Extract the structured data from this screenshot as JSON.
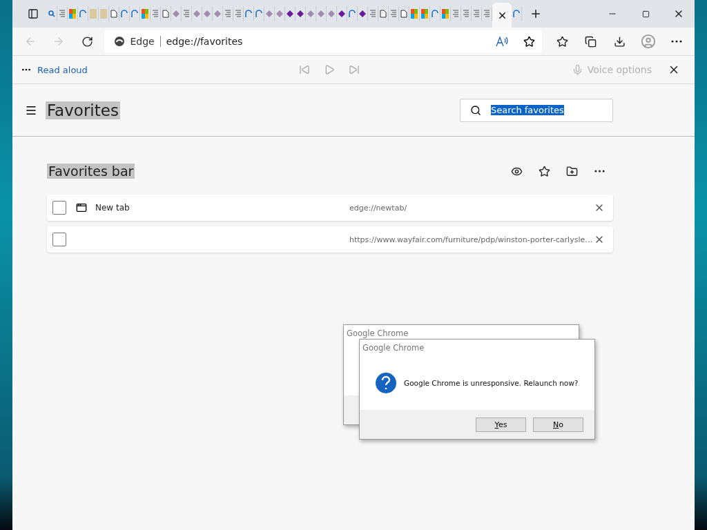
{
  "tabs": [
    {
      "kind": "search",
      "selected": false
    },
    {
      "kind": "doc",
      "selected": false
    },
    {
      "kind": "tiles",
      "selected": false
    },
    {
      "kind": "arc",
      "selected": false
    },
    {
      "kind": "pale",
      "selected": false
    },
    {
      "kind": "pale",
      "selected": false
    },
    {
      "kind": "page",
      "selected": false
    },
    {
      "kind": "arc",
      "selected": false
    },
    {
      "kind": "arc",
      "selected": false
    },
    {
      "kind": "tiles",
      "selected": false
    },
    {
      "kind": "doc",
      "selected": false
    },
    {
      "kind": "page",
      "selected": false
    },
    {
      "kind": "diamond",
      "selected": false
    },
    {
      "kind": "doc",
      "selected": false
    },
    {
      "kind": "diamond",
      "selected": false
    },
    {
      "kind": "diamond",
      "selected": false
    },
    {
      "kind": "diamond",
      "selected": false
    },
    {
      "kind": "doc",
      "selected": false
    },
    {
      "kind": "doc",
      "selected": false
    },
    {
      "kind": "arc",
      "selected": false
    },
    {
      "kind": "arc",
      "selected": false
    },
    {
      "kind": "diamond",
      "selected": false
    },
    {
      "kind": "diamond",
      "selected": false
    },
    {
      "kind": "purple",
      "selected": false
    },
    {
      "kind": "purple",
      "selected": false
    },
    {
      "kind": "diamond",
      "selected": false
    },
    {
      "kind": "diamond",
      "selected": false
    },
    {
      "kind": "diamond",
      "selected": false
    },
    {
      "kind": "purple",
      "selected": false
    },
    {
      "kind": "arc",
      "selected": false
    },
    {
      "kind": "purple",
      "selected": false
    },
    {
      "kind": "doc",
      "selected": false
    },
    {
      "kind": "page",
      "selected": false
    },
    {
      "kind": "doc",
      "selected": false
    },
    {
      "kind": "page",
      "selected": false
    },
    {
      "kind": "tiles",
      "selected": false
    },
    {
      "kind": "tiles",
      "selected": false
    },
    {
      "kind": "arc",
      "selected": false
    },
    {
      "kind": "tiles",
      "selected": false
    },
    {
      "kind": "doc",
      "selected": false
    },
    {
      "kind": "doc",
      "selected": false
    },
    {
      "kind": "doc",
      "selected": false
    },
    {
      "kind": "doc",
      "selected": false
    },
    {
      "kind": "blank",
      "selected": true
    },
    {
      "kind": "arc",
      "selected": false
    }
  ],
  "address": {
    "site": "Edge",
    "url": "edge://favorites"
  },
  "read_aloud": {
    "label": "Read aloud",
    "voice_options": "Voice options"
  },
  "page": {
    "title": "Favorites",
    "title_selected": true,
    "search": {
      "value": "Search favorites",
      "selected": true
    }
  },
  "folder": {
    "title": "Favorites bar",
    "title_selected": true,
    "items": [
      {
        "kind": "page",
        "name": "New tab",
        "url": "edge://newtab/",
        "checked": false
      },
      {
        "kind": "blank",
        "url": "https://www.wayfair.com/furniture/pdp/winston-porter-carlysle…",
        "checked": false
      }
    ]
  },
  "dialogs": [
    {
      "title": "Google Chrome"
    },
    {
      "title": "Google Chrome",
      "message": "Google Chrome is unresponsive. Relaunch now?",
      "buttons": [
        {
          "label": "Yes"
        },
        {
          "label": "No"
        }
      ]
    }
  ]
}
